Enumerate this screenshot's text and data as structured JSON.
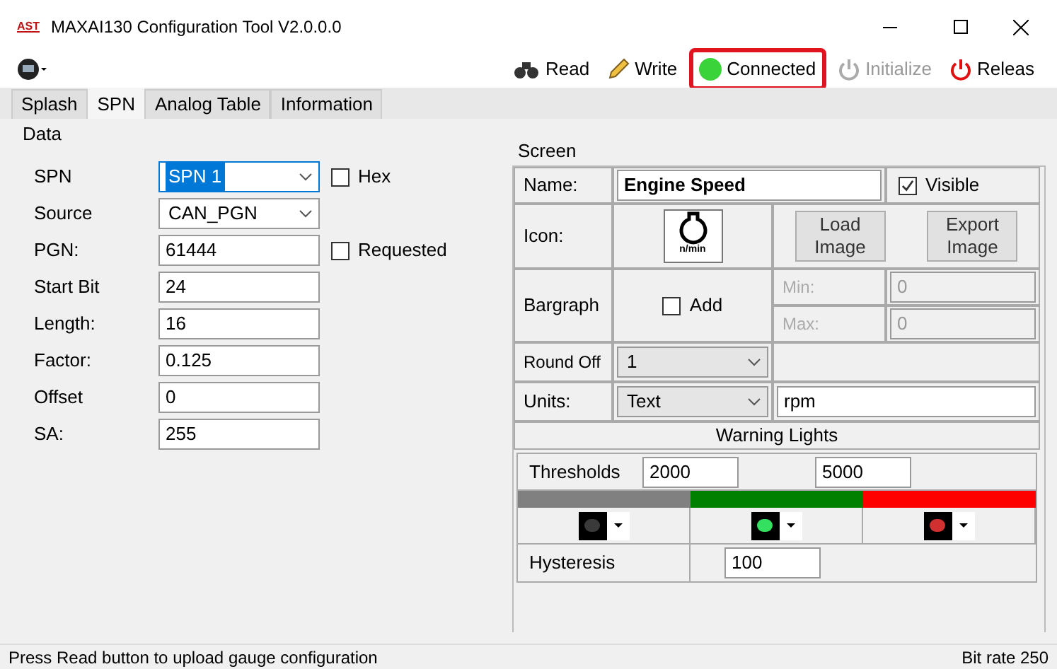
{
  "window": {
    "title": "MAXAI130 Configuration Tool V2.0.0.0",
    "logo": "AST"
  },
  "toolbar": [
    {
      "kind": "button",
      "label": "Read",
      "disabled": false
    },
    {
      "kind": "button",
      "label": "Write",
      "disabled": false
    },
    {
      "kind": "status",
      "label": "Connected",
      "on": true
    },
    {
      "kind": "power",
      "label": "Initialize",
      "disabled": true
    },
    {
      "kind": "power",
      "label": "Releas",
      "disabled": false
    }
  ],
  "tabs": [
    {
      "label": "Splash",
      "selected": false
    },
    {
      "label": "SPN",
      "selected": true
    },
    {
      "label": "Analog Table",
      "selected": false
    },
    {
      "label": "Information",
      "selected": false
    }
  ],
  "data": {
    "title": "Data",
    "fields": [
      {
        "kind": "select",
        "label": "SPN",
        "value": "SPN 1",
        "highlighted": true,
        "checkbox": {
          "label": "Hex",
          "checked": false
        }
      },
      {
        "kind": "select",
        "label": "Source",
        "value": "CAN_PGN",
        "highlighted": false
      },
      {
        "kind": "input",
        "label": "PGN:",
        "value": "61444",
        "checkbox": {
          "label": "Requested",
          "checked": false
        }
      },
      {
        "kind": "input",
        "label": "Start Bit",
        "value": "24"
      },
      {
        "kind": "input",
        "label": "Length:",
        "value": "16"
      },
      {
        "kind": "input",
        "label": "Factor:",
        "value": "0.125"
      },
      {
        "kind": "input",
        "label": "Offset",
        "value": "0"
      },
      {
        "kind": "input",
        "label": "SA:",
        "value": "255"
      }
    ]
  },
  "screen": {
    "title": "Screen",
    "name": {
      "label": "Name:",
      "value": "Engine Speed",
      "visible_label": "Visible",
      "visible": true
    },
    "icon": {
      "label": "Icon:",
      "caption": "n/min",
      "buttons": [
        "Load Image",
        "Export Image"
      ]
    },
    "bargraph": {
      "label": "Bargraph",
      "add_label": "Add",
      "add": false,
      "min_label": "Min:",
      "min": "0",
      "max_label": "Max:",
      "max": "0"
    },
    "round_off": {
      "label": "Round Off",
      "value": "1"
    },
    "units": {
      "label": "Units:",
      "type": "Text",
      "value": "rpm"
    },
    "warning_lights": {
      "title": "Warning Lights",
      "thresholds_label": "Thresholds",
      "thresholds": [
        "2000",
        "5000"
      ],
      "bands": [
        {
          "color": "#808080"
        },
        {
          "color": "#008000"
        },
        {
          "color": "#ff0000"
        }
      ],
      "lights": [
        {
          "color": "#3a3a3a"
        },
        {
          "color": "#33e060"
        },
        {
          "color": "#d03030"
        }
      ],
      "hysteresis_label": "Hysteresis",
      "hysteresis": "100"
    }
  },
  "status_bar": {
    "message": "Press Read button to upload gauge configuration",
    "bit_rate": "Bit rate 250"
  }
}
